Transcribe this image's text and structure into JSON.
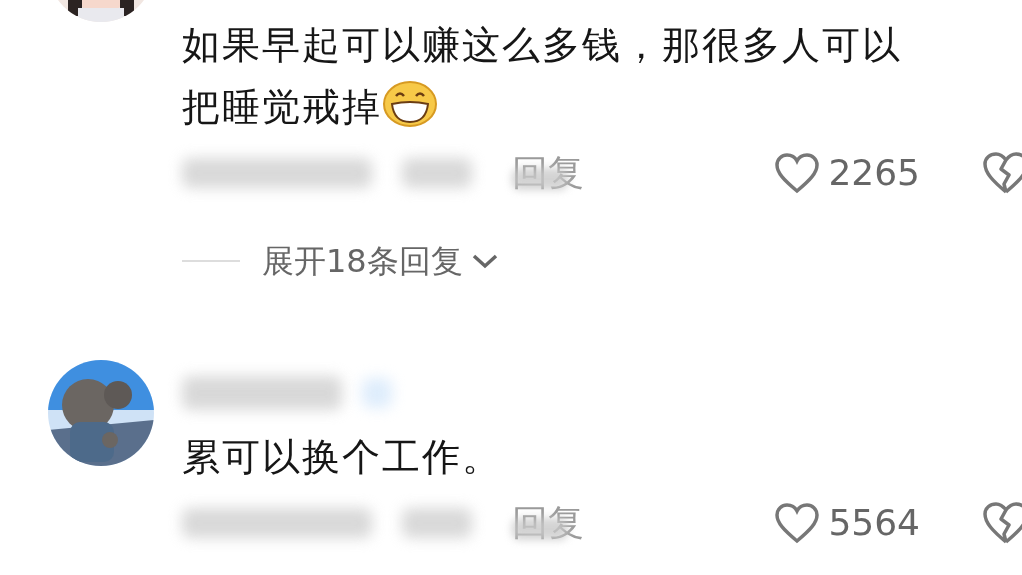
{
  "comments": [
    {
      "lines": [
        "如果早起可以赚这么多钱，那很多人可以",
        "把睡觉戒掉"
      ],
      "emoji": true,
      "name_blurred": false,
      "reply_label": "回复",
      "likes": "2265",
      "expand": "展开18条回复"
    },
    {
      "lines": [
        "累可以换个工作。"
      ],
      "emoji": false,
      "name_blurred": true,
      "reply_label": "回复",
      "likes": "5564"
    }
  ]
}
